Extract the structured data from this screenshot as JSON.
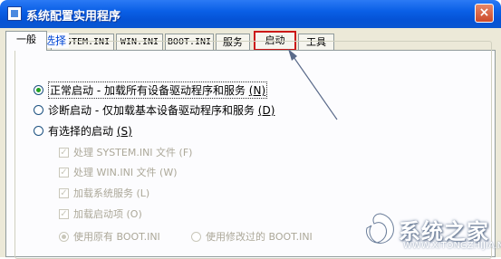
{
  "window": {
    "title": "系统配置实用程序",
    "close_label": "×"
  },
  "tabs": [
    {
      "label": "一般"
    },
    {
      "label": "SYSTEM.INI"
    },
    {
      "label": "WIN.INI"
    },
    {
      "label": "BOOT.INI"
    },
    {
      "label": "服务"
    },
    {
      "label": "启动"
    },
    {
      "label": "工具"
    }
  ],
  "group": {
    "title": "启动选择"
  },
  "options": {
    "normal": {
      "text": "正常启动 - 加载所有设备驱动程序和服务 ",
      "key": "(N)",
      "selected": true
    },
    "diagnostic": {
      "text": "诊断启动 - 仅加载基本设备驱动程序和服务 ",
      "key": "(D)",
      "selected": false
    },
    "selective": {
      "text": "有选择的启动 ",
      "key": "(S)",
      "selected": false
    }
  },
  "selective_items": [
    {
      "label": "处理 SYSTEM.INI 文件 (F)"
    },
    {
      "label": "处理 WIN.INI 文件 (W)"
    },
    {
      "label": "加载系统服务 (L)"
    },
    {
      "label": "加载启动项 (O)"
    }
  ],
  "boot_options": {
    "original": "使用原有 BOOT.INI",
    "modified": "使用修改过的 BOOT.INI"
  },
  "watermark": {
    "text": "系统之家",
    "url": "WWW.XITONGZHIJIA.NET"
  },
  "colors": {
    "titlebar": "#0553d6",
    "highlight_box": "#cc1818",
    "group_title": "#0046d5"
  }
}
